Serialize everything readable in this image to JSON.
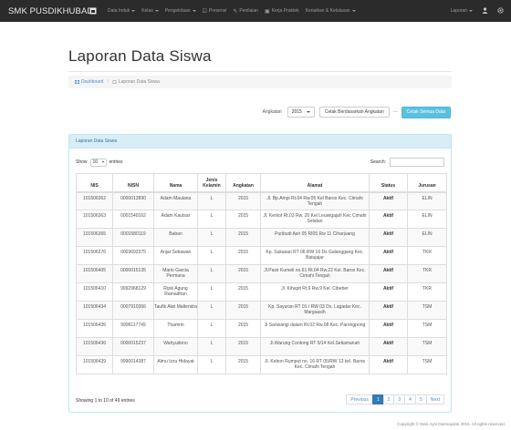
{
  "navbar": {
    "brand": "SMK PUSDIKHUBAD",
    "items": [
      {
        "label": "Data Induk",
        "icon": "",
        "dropdown": true
      },
      {
        "label": "Kelas",
        "icon": "",
        "dropdown": true
      },
      {
        "label": "Pengelolaan",
        "icon": "",
        "dropdown": true
      },
      {
        "label": "Presensi",
        "icon": "☑",
        "dropdown": false
      },
      {
        "label": "Penilaian",
        "icon": "✎",
        "dropdown": false
      },
      {
        "label": "Kerja Praktek",
        "icon": "▣",
        "dropdown": false
      },
      {
        "label": "Kenaikan & Kelulusan",
        "icon": "",
        "dropdown": true
      }
    ],
    "right": {
      "laporan": "Laporan"
    }
  },
  "page": {
    "title": "Laporan Data Siswa",
    "breadcrumb": {
      "home": "Dashboard",
      "current": "Laporan Data Siswa"
    }
  },
  "filter": {
    "label": "Angkatan",
    "selected": "2015",
    "filter_button": "Cetak Berdasarkan Angkatan",
    "separator": "---",
    "print_all_button": "Cetak Semua Data"
  },
  "panel": {
    "heading": "Laporan Data Siswa",
    "show_label": "Show",
    "show_value": "10",
    "entries_label": "entries",
    "search_label": "Search:",
    "columns": [
      "NIS",
      "NISN",
      "Nama",
      "Jenis Kelamin",
      "Angkatan",
      "Alamat",
      "Status",
      "Jurusan"
    ],
    "rows": [
      [
        "101506362",
        "0000013890",
        "Adam Maulana",
        "L",
        "2015",
        "Jl. Bp.Ampi Rt.04 Rw.05 Kel Baros Kec. Cimahi Tengah",
        "Aktif",
        "ELIN"
      ],
      [
        "101506363",
        "0001540162",
        "Adam Kautsar",
        "L",
        "2015",
        "Jl. Kerkof Rt.03 Rw. 20 Kel Leuwigajah Kec Cimahi Selatan",
        "Aktif",
        "ELIN"
      ],
      [
        "101506365",
        "0001580119",
        "Baban",
        "L",
        "2015",
        "Puribudi Asri 05 RI05 Rw 11 Ciharjuang",
        "Aktif",
        "ELIN"
      ],
      [
        "101506376",
        "0003692375",
        "Anjar Setiawan",
        "L",
        "2015",
        "Kp. Sukasari RT 06 RW 16 Ds Galanggang Kec. Batujajar",
        "Aktif",
        "TKR"
      ],
      [
        "101506405",
        "0000015135",
        "Mario Garcia Permana",
        "L",
        "2015",
        "Jl.Pasir Kumeli no.61 Rt.04 Rw.22 Kel. Baros Kec. Cimahi Tengah",
        "Aktif",
        "TKR"
      ],
      [
        "101506410",
        "9992968129",
        "Rizki Agung Ramadhan",
        "L",
        "2015",
        "Jl. Kihapit Rt.6 Rw.9 Kel. Cibeber",
        "Aktif",
        "TKR"
      ],
      [
        "101506434",
        "0007910366",
        "Taufik Alwi Maltendra",
        "L",
        "2015",
        "Kp. Sayuran RT 01 / RW 03 Ds. Lagadar Kec. Margaasih",
        "Aktif",
        "TSM"
      ],
      [
        "101506435",
        "9996117749",
        "Thamrin",
        "L",
        "2015",
        "Jl Sariwangi dalam Rt.02 Rw.08 Kec. Parongpong",
        "Aktif",
        "TSM"
      ],
      [
        "101506436",
        "0000015237",
        "Wahyudono",
        "L",
        "2015",
        "Jl.Warung Contong RT 5/14 Kel.Setiamanah",
        "Aktif",
        "TSM"
      ],
      [
        "101506439",
        "9990014387",
        "Almu Izzu Hidayat",
        "L",
        "2015",
        "Jl. Kebon Rumput no. 16 RT 05/RW 13 kel. Baros Kec. Cimahi Tengah",
        "Aktif",
        "TSM"
      ]
    ],
    "info": "Showing 1 to 10 of 49 entries",
    "pagination": {
      "prev": "Previous",
      "pages": [
        "1",
        "2",
        "3",
        "4",
        "5"
      ],
      "next": "Next",
      "active": "1"
    }
  },
  "footer": "Copyright © Desi Ayni Darmayanti 2016. All rights reserved.",
  "colors": {
    "navbar": "#2b2b2b",
    "info_button": "#5bc0de",
    "panel_heading": "#d9edf7",
    "link": "#4a8fd2",
    "active_page": "#337ab7"
  }
}
